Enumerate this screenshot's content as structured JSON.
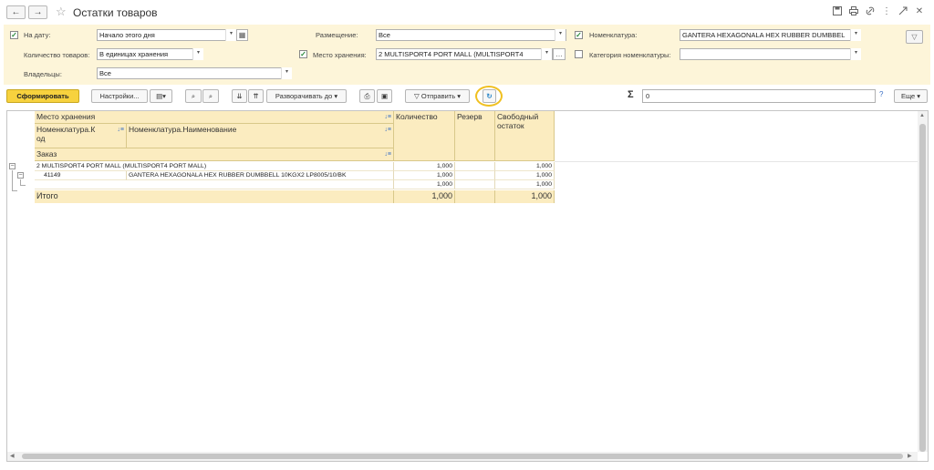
{
  "window": {
    "title": "Остатки товаров",
    "back_icon": "←",
    "forward_icon": "→",
    "star_icon": "☆"
  },
  "filters": {
    "date_label": "На дату:",
    "date_value": "Начало этого дня",
    "qty_label": "Количество товаров:",
    "qty_value": "В единицах хранения",
    "owners_label": "Владельцы:",
    "owners_value": "Все",
    "placement_label": "Размещение:",
    "placement_value": "Все",
    "storage_label": "Место хранения:",
    "storage_value": "2 MULTISPORT4 PORT MALL (MULTISPORT4",
    "nomenclature_label": "Номенклатура:",
    "nomenclature_value": "GANTERA HEXAGONALA HEX RUBBER DUMBBEL",
    "category_label": "Категория номенклатуры:",
    "category_value": "",
    "date_checked": true,
    "storage_checked": true,
    "nomenclature_checked": true,
    "category_checked": false
  },
  "toolbar": {
    "generate": "Сформировать",
    "settings": "Настройки...",
    "expand": "Разворачивать до",
    "send": "Отправить",
    "sum_value": "0",
    "help": "?",
    "more": "Еще"
  },
  "report": {
    "header": {
      "storage": "Место хранения",
      "code_line1": "Номенклатура.К",
      "code_line2": "од",
      "name": "Номенклатура.Наименование",
      "order": "Заказ",
      "qty": "Количество",
      "reserve": "Резерв",
      "free_line1": "Свободный",
      "free_line2": "остаток"
    },
    "rows": [
      {
        "label": "2 MULTISPORT4 PORT MALL (MULTISPORT4 PORT MALL)",
        "qty": "1,000",
        "reserve": "",
        "free": "1,000"
      },
      {
        "code": "41149",
        "name": "GANTERA HEXAGONALA HEX RUBBER DUMBBELL 10KGX2 LP8005/10/BK",
        "qty": "1,000",
        "reserve": "",
        "free": "1,000"
      },
      {
        "code": "",
        "name": "",
        "qty": "1,000",
        "reserve": "",
        "free": "1,000"
      }
    ],
    "total": {
      "label": "Итого",
      "qty": "1,000",
      "reserve": "",
      "free": "1,000"
    }
  },
  "colors": {
    "filter_bg": "#fdf5d9",
    "primary_button": "#f7d23e",
    "header_bg": "#fbecc0",
    "highlight_ring": "#f0c020"
  }
}
